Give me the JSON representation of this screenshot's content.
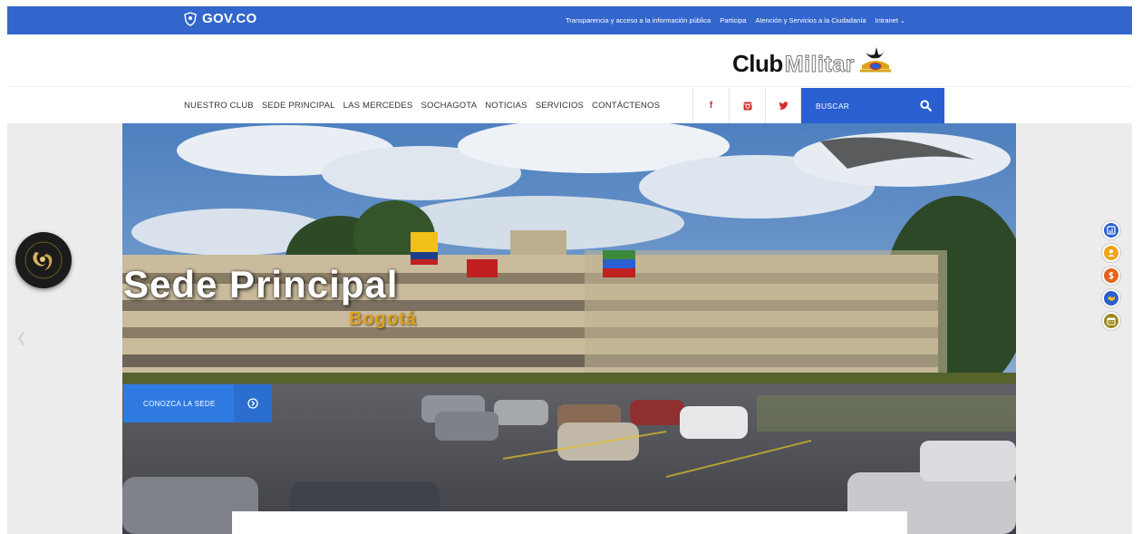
{
  "govbar": {
    "brand": "GOV.CO",
    "links": [
      "Transparencia y acceso a la información pública",
      "Participa",
      "Atención y Servicios a la Ciudadanía",
      "Intranet"
    ],
    "color": "#3366cc"
  },
  "brand": {
    "club": "Club",
    "militar": "Militar"
  },
  "nav": {
    "items": [
      "NUESTRO CLUB",
      "SEDE PRINCIPAL",
      "LAS MERCEDES",
      "SOCHAGOTA",
      "NOTICIAS",
      "SERVICIOS",
      "CONTÁCTENOS"
    ],
    "social": {
      "facebook": "f",
      "instagram": "instagram-icon",
      "twitter": "twitter-icon"
    },
    "search_label": "BUSCAR",
    "accent": "#2a5fd1"
  },
  "hero": {
    "title": "Sede Principal",
    "subtitle": "Bogotá",
    "button_label": "CONOZCA LA SEDE"
  },
  "quick_links": [
    "chart-icon",
    "user-icon",
    "dollar-icon",
    "handshake-icon",
    "calendar-icon"
  ]
}
